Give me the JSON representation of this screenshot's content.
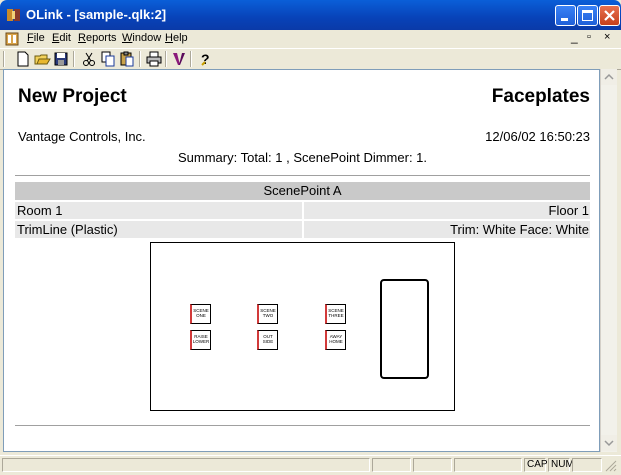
{
  "window": {
    "title": "OLink - [sample-.qlk:2]",
    "minimize_icon": "minimize-icon",
    "maximize_icon": "maximize-icon",
    "close_icon": "close-icon"
  },
  "menu": {
    "items": [
      "File",
      "Edit",
      "Reports",
      "Window",
      "Help"
    ]
  },
  "toolbar": {
    "icons": [
      "new-icon",
      "open-icon",
      "save-icon",
      "cut-icon",
      "copy-icon",
      "paste-icon",
      "print-icon",
      "vantage-logo-icon",
      "help-icon"
    ]
  },
  "report": {
    "title": "New Project",
    "right_title": "Faceplates",
    "company": "Vantage Controls, Inc.",
    "datestamp": "12/06/02 16:50:23",
    "summary": "Summary: Total: 1 , ScenePoint Dimmer: 1.",
    "section": {
      "header": "ScenePoint A",
      "room": "Room 1",
      "floor": "Floor 1",
      "trimline": "TrimLine (Plastic)",
      "trim": "Trim: White Face: White"
    },
    "faceplate_buttons": [
      {
        "line1": "SCENE",
        "line2": "ONE"
      },
      {
        "line1": "SCENE",
        "line2": "TWO"
      },
      {
        "line1": "SCENE",
        "line2": "THREE"
      },
      {
        "line1": "RAISE",
        "line2": "LOWER"
      },
      {
        "line1": "OUT",
        "line2": "SIDE"
      },
      {
        "line1": "AWAY",
        "line2": "HOME"
      }
    ]
  },
  "statusbar": {
    "cap": "CAP",
    "num": "NUM"
  },
  "colors": {
    "titlebar": "#0a5fd8",
    "section_header": "#c9c9c9",
    "row_bg": "#e8e8e8",
    "button_accent": "#d23a3a"
  }
}
